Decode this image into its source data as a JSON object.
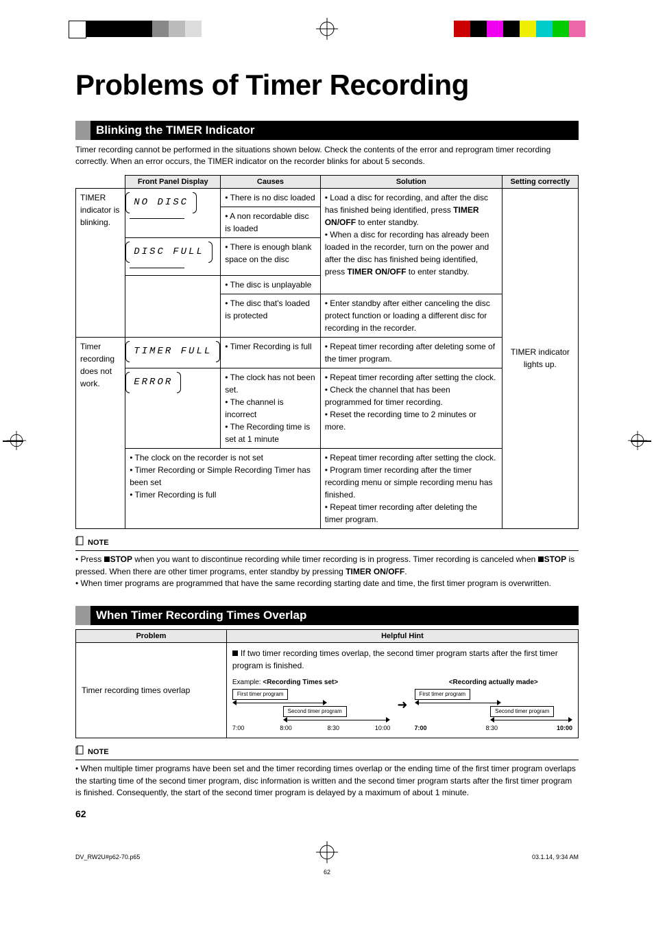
{
  "title": "Problems of Timer Recording",
  "section1": {
    "heading": "Blinking the TIMER Indicator",
    "intro": "Timer recording cannot be performed in the situations shown below. Check the contents of the error and reprogram timer recording correctly. When an error occurs, the TIMER indicator on the recorder blinks for about 5 seconds.",
    "headers": {
      "c0": "",
      "c1": "Front Panel Display",
      "c2": "Causes",
      "c3": "Solution",
      "c4": "Setting correctly"
    },
    "group1_label": "TIMER indicator is blinking.",
    "group2_label": "Timer recording does not work.",
    "displays": {
      "no_disc": "NO  DISC",
      "disc_full": "DISC  FULL",
      "timer_full": "TIMER FULL",
      "error": "ERROR"
    },
    "causes": {
      "r1": "• There is no disc loaded",
      "r2": "• A non recordable disc is loaded",
      "r3": "• There is enough blank space on the disc",
      "r4": "• The disc is unplayable",
      "r5": "• The disc that's loaded is protected",
      "r6": "• Timer Recording is full",
      "r7a": "• The clock has not been set.",
      "r7b": "• The channel is incorrect",
      "r7c": "• The Recording time is set at 1 minute",
      "r8a": "• The clock on the recorder is not set",
      "r8b": "• Timer Recording or Simple Recording Timer has been set",
      "r8c": "• Timer Recording is full"
    },
    "solutions": {
      "s1a": "• Load a disc for recording, and after the disc has finished being identified, press ",
      "s1b": " to enter standby.",
      "s1c": "• When a disc for recording has already been loaded in the recorder, turn on the power and after the disc has finished being identified, press ",
      "s1d": " to enter standby.",
      "s1_btn": "TIMER ON/OFF",
      "s1_btn2": "TIMER ON/OFF",
      "s5": "• Enter standby after either canceling the disc protect function or loading a different disc for recording in the recorder.",
      "s6": "•  Repeat timer recording after deleting some of the timer program.",
      "s7a": "•  Repeat timer recording after setting the clock.",
      "s7b": "•  Check the channel that has been programmed for timer recording.",
      "s7c": "•  Reset the recording time to 2 minutes or more.",
      "s8a": "•  Repeat timer recording after setting the clock.",
      "s8b": "•  Program timer recording after the timer recording menu or simple recording menu has finished.",
      "s8c": "•  Repeat timer recording after deleting the timer program."
    },
    "setting_correctly": "TIMER indicator lights up."
  },
  "note1": {
    "label": "NOTE",
    "b1a": "Press ",
    "b1b": "STOP",
    "b1c": " when you want to discontinue recording while timer recording is in progress. Timer recording is canceled when ",
    "b1d": "STOP",
    "b1e": " is pressed. When there are other timer programs, enter standby by pressing ",
    "b1f": "TIMER ON/OFF",
    "b1g": ".",
    "b2": "When timer programs are programmed that have the same recording starting date and time, the first timer program is overwritten."
  },
  "section2": {
    "heading": "When Timer Recording Times Overlap",
    "headers": {
      "problem": "Problem",
      "hint": "Helpful Hint"
    },
    "problem": "Timer recording times overlap",
    "hint_text": "If two timer recording times overlap, the second timer program starts after the first timer program is finished.",
    "example_label": "Example: ",
    "set_label": "<Recording Times set>",
    "made_label": "<Recording actually made>",
    "first": "First timer program",
    "second": "Second timer program",
    "times": {
      "t1": "7:00",
      "t2": "8:00",
      "t3": "8:30",
      "t4": "10:00",
      "m1": "7:00",
      "m2": "8:30",
      "m3": "10:00"
    }
  },
  "note2": {
    "label": "NOTE",
    "b1": "When multiple timer programs have been set and the timer recording times overlap or the ending time of the first timer program overlaps the starting time of the second timer program, disc information is written and the second timer program starts after the first timer program is finished. Consequently, the start of the second timer program is delayed by a maximum of about 1 minute."
  },
  "page_number": "62",
  "footer": {
    "file": "DV_RW2U#p62-70.p65",
    "page": "62",
    "date": "03.1.14, 9:34 AM"
  }
}
